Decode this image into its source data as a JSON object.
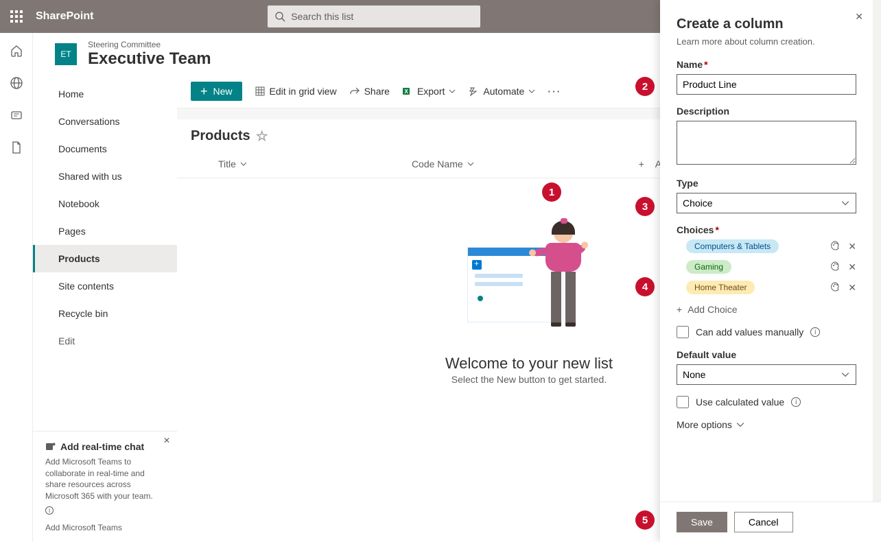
{
  "topbar": {
    "brand": "SharePoint",
    "search_placeholder": "Search this list"
  },
  "site": {
    "parent": "Steering Committee",
    "title": "Executive Team",
    "tile": "ET"
  },
  "nav": {
    "items": [
      "Home",
      "Conversations",
      "Documents",
      "Shared with us",
      "Notebook",
      "Pages",
      "Products",
      "Site contents",
      "Recycle bin",
      "Edit"
    ],
    "selected_index": 6
  },
  "teams_promo": {
    "title": "Add real-time chat",
    "body": "Add Microsoft Teams to collaborate in real-time and share resources across Microsoft 365 with your team.",
    "link": "Add Microsoft Teams"
  },
  "commands": {
    "new": "New",
    "edit_grid": "Edit in grid view",
    "share": "Share",
    "export": "Export",
    "automate": "Automate"
  },
  "list": {
    "title": "Products",
    "columns": [
      "Title",
      "Code Name",
      "Add column"
    ],
    "empty_title": "Welcome to your new list",
    "empty_sub": "Select the New button to get started."
  },
  "panel": {
    "title": "Create a column",
    "learn_more": "Learn more about column creation.",
    "name_label": "Name",
    "name_value": "Product Line",
    "desc_label": "Description",
    "desc_value": "",
    "type_label": "Type",
    "type_value": "Choice",
    "choices_label": "Choices",
    "choices": [
      {
        "text": "Computers & Tablets",
        "cls": "blue"
      },
      {
        "text": "Gaming",
        "cls": "green"
      },
      {
        "text": "Home Theater",
        "cls": "yellow"
      }
    ],
    "add_choice": "Add Choice",
    "manual_label": "Can add values manually",
    "default_label": "Default value",
    "default_value": "None",
    "calc_label": "Use calculated value",
    "more": "More options",
    "save": "Save",
    "cancel": "Cancel"
  },
  "callouts": [
    "1",
    "2",
    "3",
    "4",
    "5"
  ]
}
